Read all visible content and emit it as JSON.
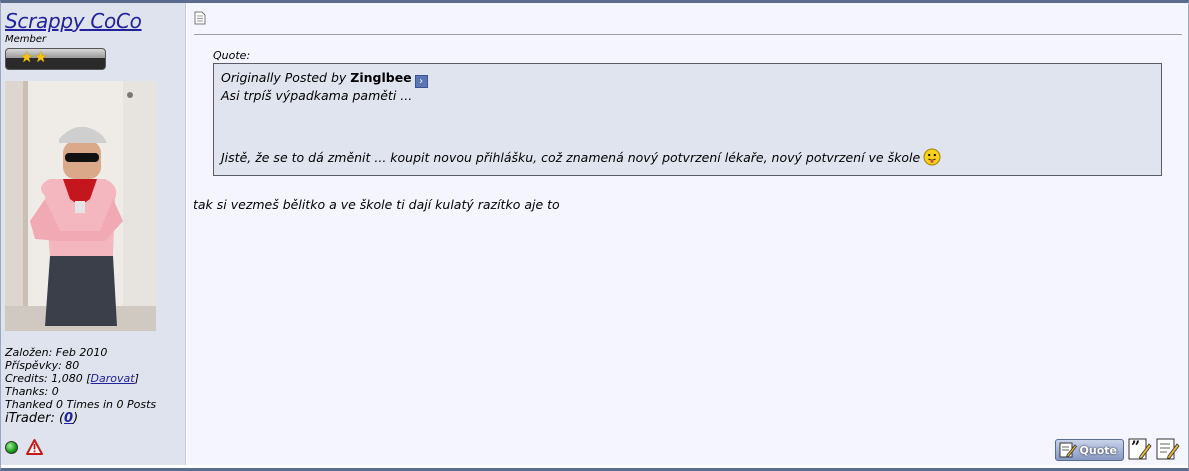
{
  "user": {
    "name": "Scrappy CoCo",
    "title": "Member",
    "stats": {
      "joined": "Založen: Feb 2010",
      "posts": "Příspěvky: 80",
      "credits_prefix": "Credits: 1,080 [",
      "credits_link": "Darovat",
      "credits_suffix": "]",
      "thanks": "Thanks: 0",
      "thanked": "Thanked 0 Times in 0 Posts",
      "itrader_prefix": "iTrader: (",
      "itrader_value": "0",
      "itrader_suffix": ")"
    },
    "online_status_icon": "online-dot-icon",
    "report_icon": "warning-triangle-icon"
  },
  "post": {
    "quote": {
      "label": "Quote:",
      "originally_posted_by": "Originally Posted by",
      "author": "Zinglbee",
      "line1": "Asi trpíš výpadkama paměti ...",
      "line2": "Jistě, že se to dá změnit ... koupit novou přihlášku, což znamená nový potvrzení lékaře, nový potvrzení ve škole"
    },
    "body": "tak si vezmeš bělitko a ve škole ti dají kulatý razítko aje to",
    "buttons": {
      "quote_label": "Quote"
    }
  },
  "colors": {
    "frame": "#5a6b8c",
    "sidebar_bg": "#dfe3ee",
    "post_bg": "#f5f5ff",
    "quote_bg": "#e0e4ef",
    "link": "#22229c"
  }
}
